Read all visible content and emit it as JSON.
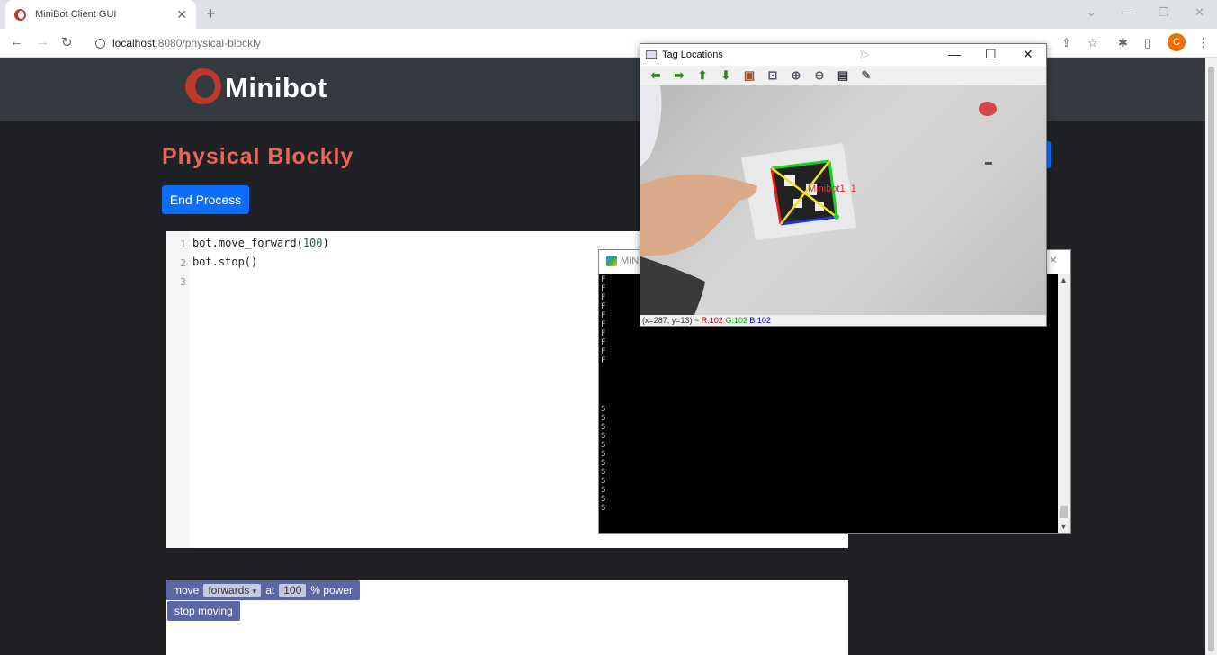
{
  "browser": {
    "tab_title": "MiniBot Client GUI",
    "tab_close": "✕",
    "new_tab": "+",
    "url_host": "localhost",
    "url_path": ":8080/physical-blockly",
    "profile_initial": "C",
    "window_controls": {
      "dropdown": "⌄",
      "minimize": "—",
      "restore": "❐",
      "close": "✕"
    }
  },
  "navbar": {
    "brand": "Minibot"
  },
  "page": {
    "title": "Physical Blockly",
    "end_process_label": "End Process"
  },
  "editor": {
    "line_numbers": [
      "1",
      "2",
      "3"
    ],
    "lines": [
      {
        "text": "bot.move_forward(",
        "num": "100",
        "tail": ")"
      },
      {
        "text": "bot.stop()",
        "num": "",
        "tail": ""
      },
      {
        "text": "",
        "num": "",
        "tail": ""
      }
    ]
  },
  "blocks": {
    "move": {
      "label": "move",
      "direction": "forwards",
      "dropdown": "▾",
      "at": "at",
      "power_value": "100",
      "unit": "% power"
    },
    "stop": {
      "label": "stop moving"
    }
  },
  "console": {
    "title": "MIN",
    "close": "✕",
    "lines_f": [
      "F",
      "F",
      "F",
      "F",
      "F",
      "F",
      "F",
      "F",
      "F",
      "F"
    ],
    "lines_s": [
      "S",
      "S",
      "S",
      "S",
      "S",
      "S",
      "S",
      "S",
      "S",
      "S",
      "S",
      "S"
    ]
  },
  "tag_window": {
    "title": "Tag Locations",
    "minimize": "—",
    "maximize": "☐",
    "close": "✕",
    "tag_label": "Minibot1_1",
    "status_prefix": "(x=287, y=13) ~ ",
    "status_r": "R:102",
    "status_g": "G:102",
    "status_b": "B:102"
  }
}
